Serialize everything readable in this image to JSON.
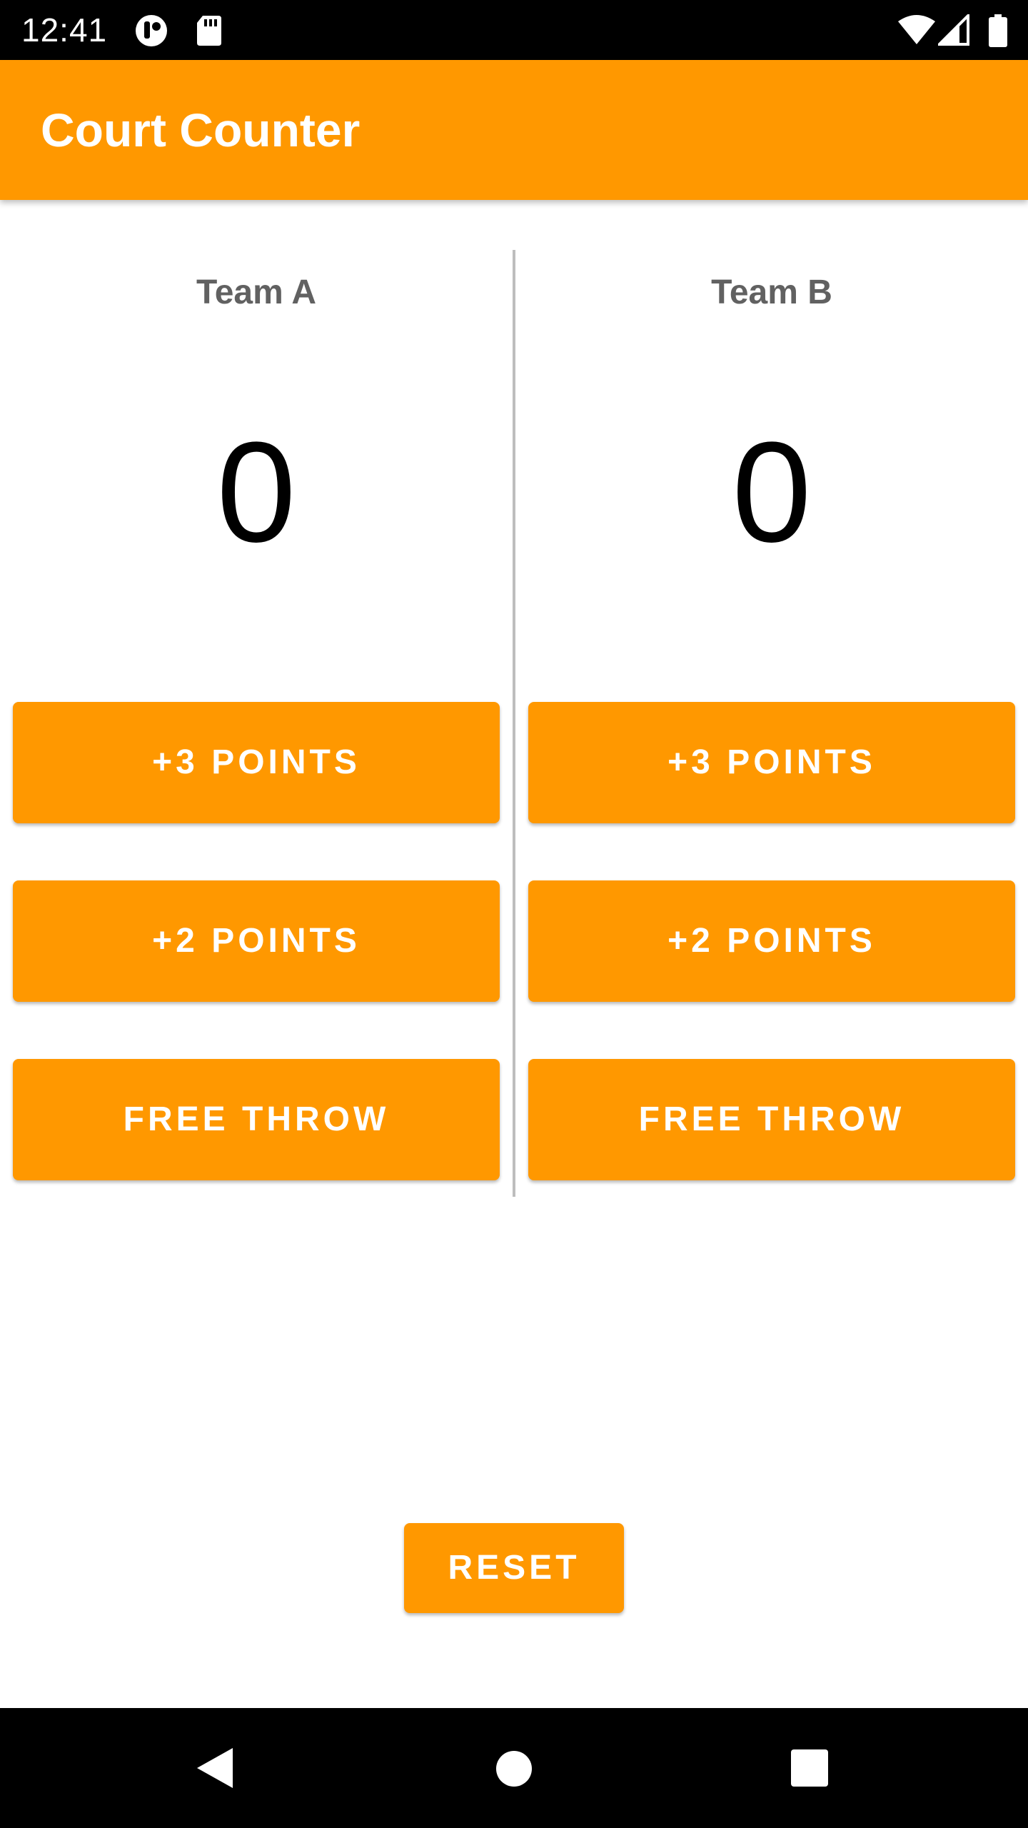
{
  "status_bar": {
    "time": "12:41",
    "left_icons": [
      "app-notification-icon",
      "sd-card-icon"
    ],
    "right_icons": [
      "wifi-icon",
      "cell-signal-icon",
      "battery-icon"
    ]
  },
  "app_bar": {
    "title": "Court Counter"
  },
  "teams": [
    {
      "name": "Team A",
      "score": "0",
      "buttons": {
        "three": "+3 POINTS",
        "two": "+2 POINTS",
        "free_throw": "FREE THROW"
      }
    },
    {
      "name": "Team B",
      "score": "0",
      "buttons": {
        "three": "+3 POINTS",
        "two": "+2 POINTS",
        "free_throw": "FREE THROW"
      }
    }
  ],
  "reset_label": "RESET",
  "nav_bar": {
    "icons": [
      "back-icon",
      "home-icon",
      "recents-icon"
    ]
  },
  "colors": {
    "accent": "#ff9800",
    "team_name": "#616161",
    "divider": "#bdbdbd"
  }
}
